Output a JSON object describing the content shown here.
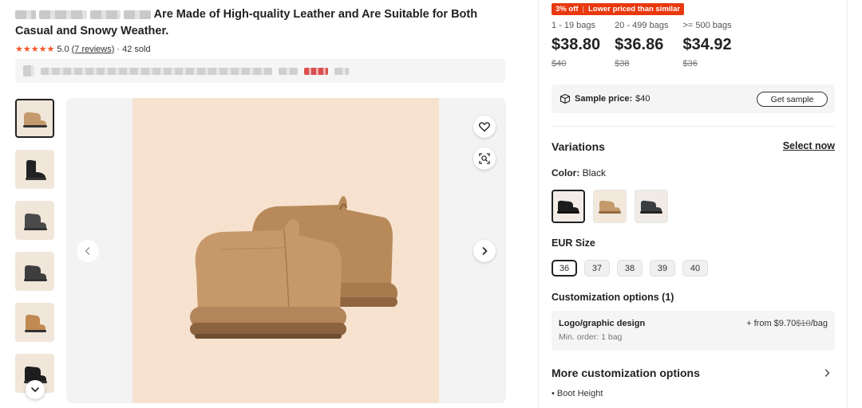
{
  "product": {
    "title_visible": "Are Made of High-quality Leather and Are Suitable for Both Casual and Snowy Weather.",
    "rating": "5.0",
    "reviews_link": "(7 reviews)",
    "sold": "· 42 sold"
  },
  "gallery": {
    "thumbnail_colors": [
      "#c49a6c",
      "#222222",
      "#4a4a4a",
      "#3e3e3e",
      "#c08a52",
      "#1e1e1e"
    ]
  },
  "pricing": {
    "promo_discount": "3% off",
    "promo_note": "Lower priced than similar",
    "tiers": [
      {
        "range": "1 - 19 bags",
        "price": "$38.80",
        "original": "$40"
      },
      {
        "range": "20 - 499 bags",
        "price": "$36.86",
        "original": "$38"
      },
      {
        "range": ">= 500 bags",
        "price": "$34.92",
        "original": "$36"
      }
    ],
    "sample_label": "Sample price:",
    "sample_price": "$40",
    "get_sample": "Get sample"
  },
  "variations": {
    "heading": "Variations",
    "select_now": "Select now",
    "color_label": "Color:",
    "color_value": "Black",
    "swatch_colors": [
      "#1c1c1c",
      "#c49a6c",
      "#3a3d42"
    ],
    "size_label": "EUR Size",
    "sizes": [
      "36",
      "37",
      "38",
      "39",
      "40"
    ]
  },
  "customization": {
    "heading": "Customization options (1)",
    "option_name": "Logo/graphic design",
    "option_price_prefix": "+ from $9.70",
    "option_price_orig": "$10",
    "option_price_unit": "/bag",
    "option_min": "Min. order: 1 bag",
    "more_heading": "More customization options",
    "bullet": "• Boot Height"
  },
  "colors": {
    "accent_orange": "#e8380d",
    "star": "#f2582a",
    "boot_tan": "#c49a6c"
  }
}
